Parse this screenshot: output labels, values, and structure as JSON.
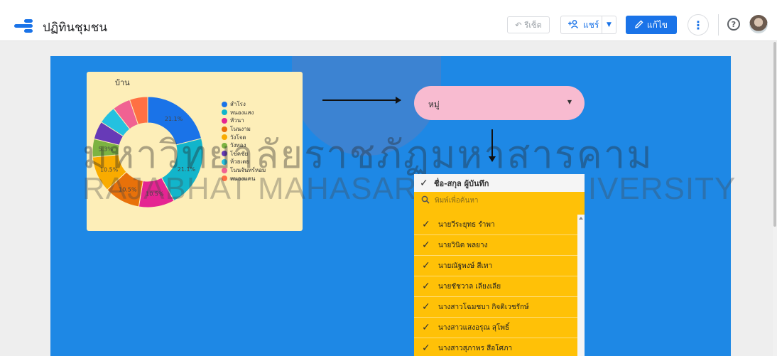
{
  "app": {
    "title": "ปฏิทินชุมชน",
    "reset_label": "รีเซ็ต",
    "share_label": "แชร์",
    "edit_label": "แก้ไข",
    "help_label": "?"
  },
  "watermark": {
    "line1": "มหาวิทยาลัยราชภัฏมหาสารคาม",
    "line2": "RAJABHAT MAHASARAKHAM UNIVERSITY"
  },
  "chart_data": {
    "type": "pie",
    "title": "บ้าน",
    "donut": true,
    "categories": [
      "สำโรง",
      "หนองแสง",
      "หัวนา",
      "โนนงาม",
      "วังโจด",
      "วังทอง",
      "โขคชัย",
      "ห้วยเตย",
      "โนนจันทร์หอม",
      "หนองแคน"
    ],
    "values": [
      21.1,
      21.1,
      10.5,
      10.5,
      10.5,
      5.3,
      5.3,
      5.3,
      5.3,
      5.3
    ],
    "data_labels": [
      "21.1%",
      "21.1%",
      "10.5%",
      "10.5%",
      "10.5%",
      "5.3%",
      "",
      "",
      "",
      ""
    ],
    "colors": [
      "#1a73e8",
      "#12b5cb",
      "#e52592",
      "#e8710a",
      "#f9ab00",
      "#7cb342",
      "#673ab7",
      "#24c1e0",
      "#f06292",
      "#ff7043"
    ],
    "legend_position": "right"
  },
  "moo_filter": {
    "label": "หมู่"
  },
  "name_filter": {
    "header": "ชื่อ-สกุล ผู้บันทึก",
    "search_placeholder": "พิมพ์เพื่อค้นหา",
    "items": [
      "นายวีระยุทธ รำพา",
      "นายวินิต พลยาง",
      "นายณัฐพงษ์ สีเทา",
      "นายชัชวาล เลียงเลีย",
      "นางสาวโฉมชบา กิจติเวชรักษ์",
      "นางสาวแสงอรุณ สุโพธิ์",
      "นางสาวสุภาพร สีอโศภา"
    ]
  }
}
